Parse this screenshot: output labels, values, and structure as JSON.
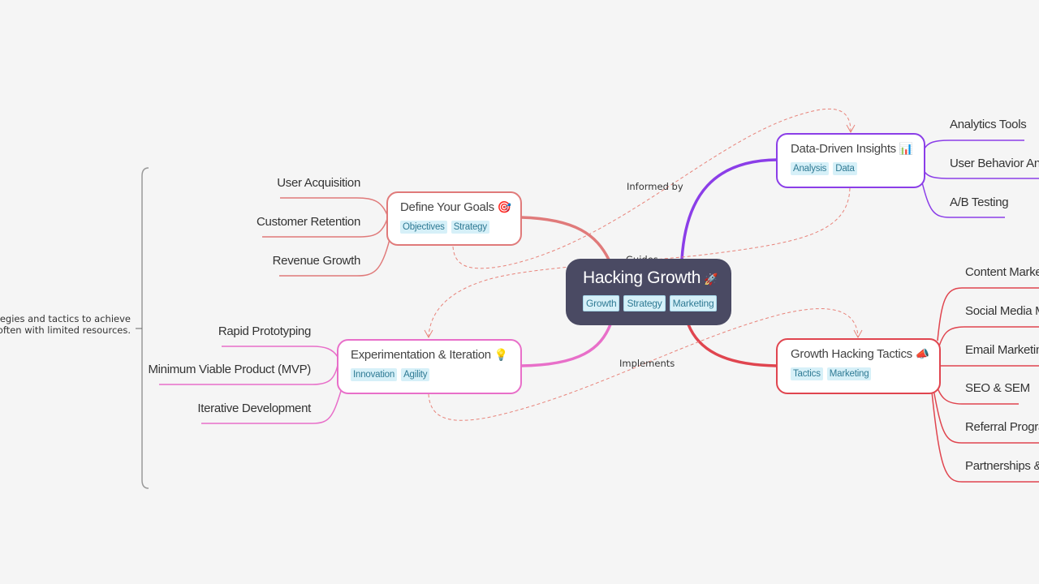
{
  "root": {
    "title": "Hacking Growth",
    "emoji": "🚀",
    "tags": [
      "Growth",
      "Strategy",
      "Marketing"
    ]
  },
  "summary_note": {
    "lines": [
      "strategies and tactics to achieve",
      "th, often with limited resources."
    ]
  },
  "branches": [
    {
      "id": "goals",
      "title": "Define Your Goals",
      "emoji": "🎯",
      "color": "#e07a7a",
      "tags": [
        "Objectives",
        "Strategy"
      ],
      "children": [
        "User Acquisition",
        "Customer Retention",
        "Revenue Growth"
      ]
    },
    {
      "id": "experiment",
      "title": "Experimentation & Iteration",
      "emoji": "💡",
      "color": "#e86fc9",
      "tags": [
        "Innovation",
        "Agility"
      ],
      "children": [
        "Rapid Prototyping",
        "Minimum Viable Product (MVP)",
        "Iterative Development"
      ]
    },
    {
      "id": "data",
      "title": "Data-Driven Insights",
      "emoji": "📊",
      "color": "#8b3ee8",
      "tags": [
        "Analysis",
        "Data"
      ],
      "children": [
        "Analytics Tools",
        "User Behavior Ana",
        "A/B Testing"
      ]
    },
    {
      "id": "tactics",
      "title": "Growth Hacking Tactics",
      "emoji": "📣",
      "color": "#e0454f",
      "tags": [
        "Tactics",
        "Marketing"
      ],
      "children": [
        "Content Market",
        "Social Media Ma",
        "Email Marketing",
        "SEO & SEM",
        "Referral Progra",
        "Partnerships &"
      ]
    }
  ],
  "relations": [
    {
      "label": "Informed by",
      "from": "goals",
      "to": "data"
    },
    {
      "label": "Guides",
      "from": "data",
      "to": "experiment"
    },
    {
      "label": "Implements",
      "from": "experiment",
      "to": "tactics"
    }
  ],
  "colors": {
    "background": "#f5f5f5",
    "root_fill": "#4a4a63",
    "tag_fill": "#d6f0f8",
    "tag_text": "#2f7a94",
    "relation_line": "#e8837a"
  }
}
